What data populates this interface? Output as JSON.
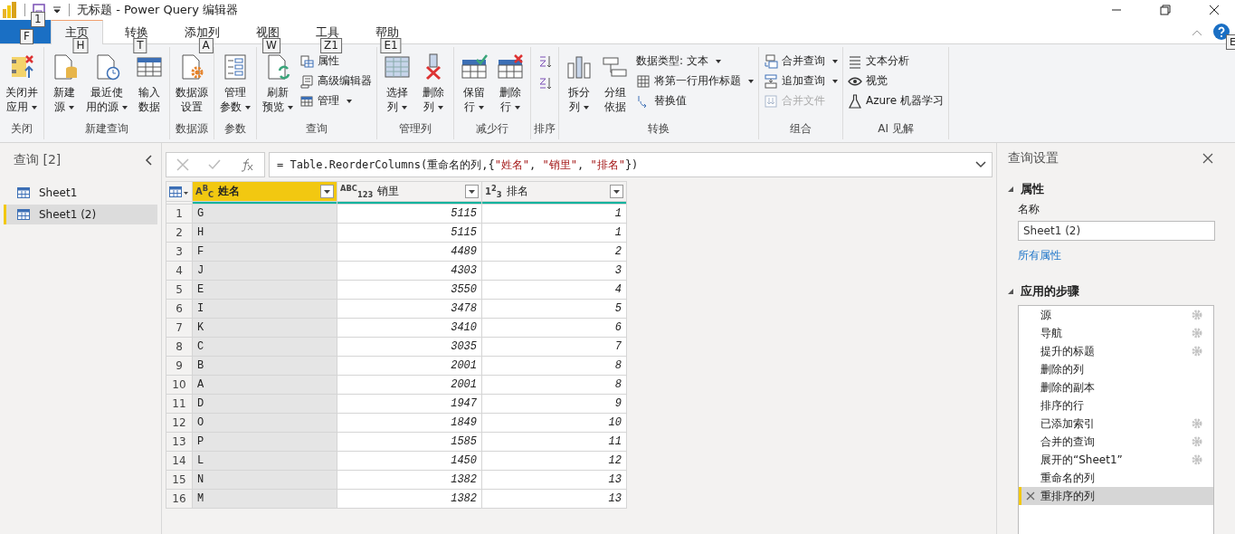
{
  "window": {
    "title": "无标题 - Power Query 编辑器",
    "save_keytip": "1"
  },
  "tabs": [
    {
      "kind": "file",
      "selected": false,
      "keytip": "F"
    },
    {
      "label": "主页",
      "kind": "tab",
      "selected": true,
      "keytip": "H"
    },
    {
      "label": "转换",
      "kind": "tab",
      "selected": false,
      "keytip": "T"
    },
    {
      "label": "添加列",
      "kind": "tab",
      "selected": false,
      "keytip": "A"
    },
    {
      "label": "视图",
      "kind": "tab",
      "selected": false,
      "keytip": "W"
    },
    {
      "label": "工具",
      "kind": "tab",
      "selected": false,
      "keytip": "Z1"
    },
    {
      "label": "帮助",
      "kind": "tab",
      "selected": false,
      "keytip": "E1"
    }
  ],
  "help_keytip": "E",
  "ribbon": [
    {
      "label": "关闭",
      "items": [
        {
          "kind": "large",
          "lines": [
            "关闭并",
            "应用"
          ],
          "dropdown": true
        }
      ]
    },
    {
      "label": "新建查询",
      "items": [
        {
          "kind": "large",
          "lines": [
            "新建",
            "源"
          ],
          "dropdown": true
        },
        {
          "kind": "large",
          "lines": [
            "最近使",
            "用的源"
          ],
          "dropdown": true
        },
        {
          "kind": "large",
          "lines": [
            "输入",
            "数据"
          ],
          "dropdown": false
        }
      ]
    },
    {
      "label": "数据源",
      "items": [
        {
          "kind": "large",
          "lines": [
            "数据源",
            "设置"
          ],
          "dropdown": false
        }
      ]
    },
    {
      "label": "参数",
      "items": [
        {
          "kind": "large",
          "lines": [
            "管理",
            "参数"
          ],
          "dropdown": true
        }
      ]
    },
    {
      "label": "查询",
      "items": [
        {
          "kind": "large",
          "lines": [
            "刷新",
            "预览"
          ],
          "dropdown": true
        },
        {
          "kind": "stack",
          "items": [
            {
              "label": "属性",
              "dropdown": false,
              "disabled": false
            },
            {
              "label": "高级编辑器",
              "dropdown": false,
              "disabled": false
            },
            {
              "label": "管理",
              "dropdown": true,
              "disabled": false
            }
          ]
        }
      ]
    },
    {
      "label": "管理列",
      "items": [
        {
          "kind": "large",
          "lines": [
            "选择",
            "列"
          ],
          "dropdown": true
        },
        {
          "kind": "large",
          "lines": [
            "删除",
            "列"
          ],
          "dropdown": true
        }
      ]
    },
    {
      "label": "减少行",
      "items": [
        {
          "kind": "large",
          "lines": [
            "保留",
            "行"
          ],
          "dropdown": true
        },
        {
          "kind": "large",
          "lines": [
            "删除",
            "行"
          ],
          "dropdown": true
        }
      ]
    },
    {
      "label": "排序",
      "items": [
        {
          "kind": "sort"
        }
      ]
    },
    {
      "label": "转换",
      "items": [
        {
          "kind": "large",
          "lines": [
            "拆分",
            "列"
          ],
          "dropdown": true
        },
        {
          "kind": "large",
          "lines": [
            "分组",
            "依据"
          ],
          "dropdown": false
        },
        {
          "kind": "stack",
          "items": [
            {
              "label": "数据类型: 文本",
              "dropdown": true,
              "disabled": false
            },
            {
              "label": "将第一行用作标题",
              "dropdown": true,
              "disabled": false
            },
            {
              "label": "替换值",
              "dropdown": false,
              "disabled": false
            }
          ]
        }
      ]
    },
    {
      "label": "组合",
      "items": [
        {
          "kind": "stack",
          "items": [
            {
              "label": "合并查询",
              "dropdown": true,
              "disabled": false
            },
            {
              "label": "追加查询",
              "dropdown": true,
              "disabled": false
            },
            {
              "label": "合并文件",
              "dropdown": false,
              "disabled": true
            }
          ]
        }
      ]
    },
    {
      "label": "AI 见解",
      "items": [
        {
          "kind": "stack",
          "items": [
            {
              "label": "文本分析",
              "dropdown": false,
              "disabled": false
            },
            {
              "label": "视觉",
              "dropdown": false,
              "disabled": false
            },
            {
              "label": "Azure 机器学习",
              "dropdown": false,
              "disabled": false
            }
          ]
        }
      ]
    }
  ],
  "queries": {
    "title": "查询 [2]",
    "items": [
      {
        "label": "Sheet1",
        "selected": false
      },
      {
        "label": "Sheet1 (2)",
        "selected": true
      }
    ]
  },
  "formula": [
    {
      "kind": "code",
      "text": "= Table.ReorderColumns(重命名的列,{"
    },
    {
      "kind": "string",
      "text": "\"姓名\""
    },
    {
      "kind": "code",
      "text": ", "
    },
    {
      "kind": "string",
      "text": "\"销里\""
    },
    {
      "kind": "code",
      "text": ", "
    },
    {
      "kind": "string",
      "text": "\"排名\""
    },
    {
      "kind": "code",
      "text": "})"
    }
  ],
  "table": {
    "columns": [
      {
        "name": "姓名",
        "type_label": "A$^{B}$$_{C}$",
        "selected": true
      },
      {
        "name": "销里",
        "type_label": "$^{ABC}$$_{123}$",
        "selected": false
      },
      {
        "name": "排名",
        "type_label": "1$^{2}$$_{3}$",
        "selected": false
      }
    ],
    "rows": [
      {
        "number": "1",
        "cells": [
          "G",
          "5115",
          "1"
        ]
      },
      {
        "number": "2",
        "cells": [
          "H",
          "5115",
          "1"
        ]
      },
      {
        "number": "3",
        "cells": [
          "F",
          "4489",
          "2"
        ]
      },
      {
        "number": "4",
        "cells": [
          "J",
          "4303",
          "3"
        ]
      },
      {
        "number": "5",
        "cells": [
          "E",
          "3550",
          "4"
        ]
      },
      {
        "number": "6",
        "cells": [
          "I",
          "3478",
          "5"
        ]
      },
      {
        "number": "7",
        "cells": [
          "K",
          "3410",
          "6"
        ]
      },
      {
        "number": "8",
        "cells": [
          "C",
          "3035",
          "7"
        ]
      },
      {
        "number": "9",
        "cells": [
          "B",
          "2001",
          "8"
        ]
      },
      {
        "number": "10",
        "cells": [
          "A",
          "2001",
          "8"
        ]
      },
      {
        "number": "11",
        "cells": [
          "D",
          "1947",
          "9"
        ]
      },
      {
        "number": "12",
        "cells": [
          "O",
          "1849",
          "10"
        ]
      },
      {
        "number": "13",
        "cells": [
          "P",
          "1585",
          "11"
        ]
      },
      {
        "number": "14",
        "cells": [
          "L",
          "1450",
          "12"
        ]
      },
      {
        "number": "15",
        "cells": [
          "N",
          "1382",
          "13"
        ]
      },
      {
        "number": "16",
        "cells": [
          "M",
          "1382",
          "13"
        ]
      }
    ]
  },
  "settings": {
    "title": "查询设置",
    "properties_heading": "属性",
    "name_label": "名称",
    "name_value": "Sheet1 (2)",
    "all_properties_link": "所有属性",
    "steps_heading": "应用的步骤",
    "steps": [
      {
        "label": "源",
        "settings": true,
        "selected": false
      },
      {
        "label": "导航",
        "settings": true,
        "selected": false
      },
      {
        "label": "提升的标题",
        "settings": true,
        "selected": false
      },
      {
        "label": "删除的列",
        "settings": false,
        "selected": false
      },
      {
        "label": "删除的副本",
        "settings": false,
        "selected": false
      },
      {
        "label": "排序的行",
        "settings": false,
        "selected": false
      },
      {
        "label": "已添加索引",
        "settings": true,
        "selected": false
      },
      {
        "label": "合并的查询",
        "settings": true,
        "selected": false
      },
      {
        "label": "展开的“Sheet1”",
        "settings": true,
        "selected": false
      },
      {
        "label": "重命名的列",
        "settings": false,
        "selected": false
      },
      {
        "label": "重排序的列",
        "settings": false,
        "selected": true
      }
    ]
  }
}
